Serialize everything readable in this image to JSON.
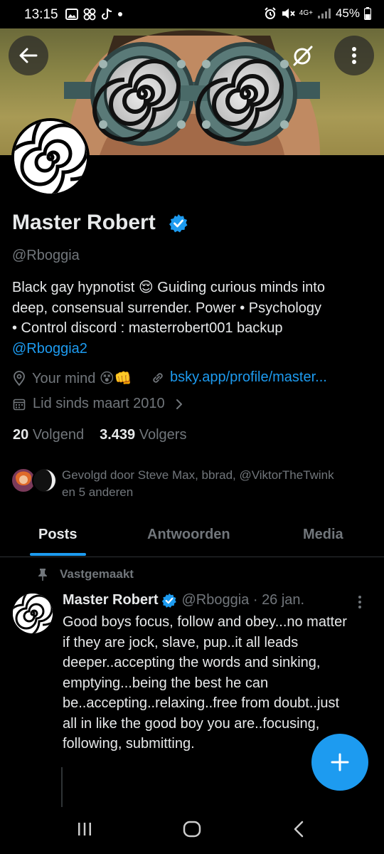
{
  "status_bar": {
    "time": "13:15",
    "battery": "45%",
    "network": "4G+"
  },
  "profile": {
    "display_name": "Master Robert",
    "handle": "@Rboggia",
    "bio_lines": [
      "Black gay hypnotist 😌  Guiding curious minds into",
      "deep, consensual surrender.  Power • Psychology",
      "• Control discord : masterrobert001 backup"
    ],
    "bio_link": "@Rboggia2",
    "location": "Your mind 😵👊",
    "website": "bsky.app/profile/master...",
    "joined": "Lid sinds maart 2010",
    "following_count": "20",
    "following_label": "Volgend",
    "followers_count": "3.439",
    "followers_label": "Volgers",
    "followed_by_line1": "Gevolgd door Steve Max, bbrad, @ViktorTheTwink",
    "followed_by_line2": "en 5 anderen"
  },
  "tabs": [
    {
      "label": "Posts",
      "active": true
    },
    {
      "label": "Antwoorden",
      "active": false
    },
    {
      "label": "Media",
      "active": false
    }
  ],
  "tweet": {
    "pinned_label": "Vastgemaakt",
    "author": "Master Robert",
    "handle_date": "@Rboggia · 26 jan.",
    "body_lines": [
      "Good boys focus, follow and obey...no matter",
      "if they are jock, slave, pup..it all leads",
      "deeper..accepting the words and sinking,",
      "emptying...being the best he can",
      "be..accepting..relaxing..free from doubt..just",
      "all in like the good boy you are..focusing,",
      "following, submitting."
    ]
  },
  "colors": {
    "accent": "#1d9bf0",
    "muted": "#71767b",
    "text": "#e7e9ea",
    "background": "#000000"
  }
}
